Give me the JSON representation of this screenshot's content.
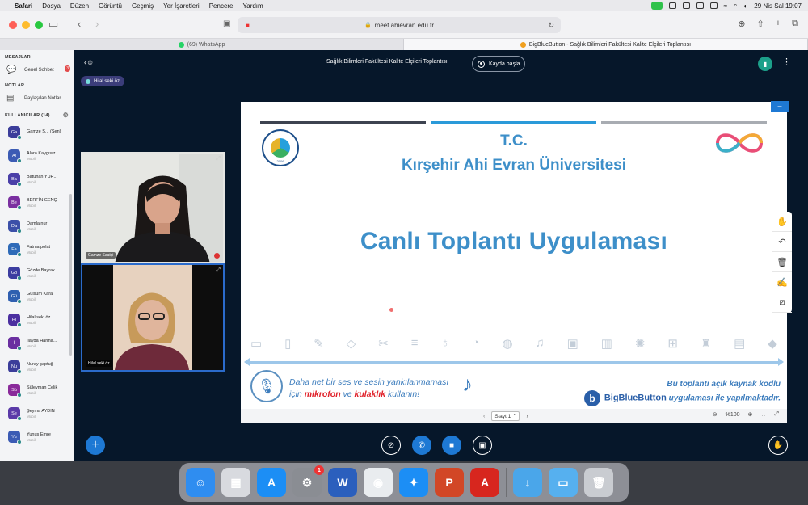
{
  "menubar": {
    "items": [
      "Safari",
      "Dosya",
      "Düzen",
      "Görüntü",
      "Geçmiş",
      "Yer İşaretleri",
      "Pencere",
      "Yardım"
    ],
    "datetime": "29 Nis Sal 19:07"
  },
  "browser": {
    "url": "meet.ahievran.edu.tr",
    "tabs": [
      {
        "label": "(69) WhatsApp"
      },
      {
        "label": "BigBlueButton - Sağlık Bilimleri Fakültesi Kalite Elçileri Toplantısı"
      }
    ]
  },
  "sidebar": {
    "messages_title": "MESAJLAR",
    "public_chat": "Genel Sohbet",
    "public_chat_badge": "3",
    "notes_title": "NOTLAR",
    "shared_notes": "Paylaşılan Notlar",
    "users_title": "KULLANICILAR (14)",
    "users": [
      {
        "initials": "Ga",
        "name": "Gamze S... (Sen)",
        "role": "",
        "color": "#3b3d9a"
      },
      {
        "initials": "Al",
        "name": "Alara Kaygısız",
        "role": "Mobil",
        "color": "#3b5bb4"
      },
      {
        "initials": "Ba",
        "name": "Batuhan YUR...",
        "role": "Mobil",
        "color": "#4a3fa8"
      },
      {
        "initials": "Be",
        "name": "BERFİN GENÇ",
        "role": "Mobil",
        "color": "#7a2fa0"
      },
      {
        "initials": "Da",
        "name": "Damla nur",
        "role": "Mobil",
        "color": "#3b4fa8"
      },
      {
        "initials": "Fa",
        "name": "Fatma polat",
        "role": "Mobil",
        "color": "#2e6ab8"
      },
      {
        "initials": "Gö",
        "name": "Gözde Bayrak",
        "role": "Mobil",
        "color": "#3c3da0"
      },
      {
        "initials": "Gü",
        "name": "Gülsüm Kara",
        "role": "Mobil",
        "color": "#2f5fb0"
      },
      {
        "initials": "Hi",
        "name": "Hilal seki öz",
        "role": "Mobil",
        "color": "#4b2fa0"
      },
      {
        "initials": "İ",
        "name": "İlayda Harma...",
        "role": "Mobil",
        "color": "#6a2fa0"
      },
      {
        "initials": "Nu",
        "name": "Nuray çaptuğ",
        "role": "Mobil",
        "color": "#3b3d9a"
      },
      {
        "initials": "Sü",
        "name": "Süleyman Çelik",
        "role": "Mobil",
        "color": "#8a2a9a"
      },
      {
        "initials": "Şe",
        "name": "Şeyma AYDIN",
        "role": "Mobil",
        "color": "#5a3aa8"
      },
      {
        "initials": "Yu",
        "name": "Yunus Emre",
        "role": "Mobil",
        "color": "#3b5bb4"
      }
    ]
  },
  "meeting": {
    "title": "Sağlık Bilimleri Fakültesi Kalite Elçileri Toplantısı",
    "record_label": "Kayda başla",
    "talker": "Hilal seki öz"
  },
  "webcams": {
    "cam1_label": "Gamze Saatçi",
    "cam2_label": "Hilal seki öz"
  },
  "slide": {
    "tc": "T.C.",
    "university": "Kırşehir Ahi Evran Üniversitesi",
    "seal_year": "2006",
    "main_title": "Canlı Toplantı Uygulaması",
    "notice_line1": "Daha net bir ses ve sesin yankılanmaması",
    "notice_line2_prefix": "için",
    "notice_mic": "mikrofon",
    "notice_and": "ve",
    "notice_headphone": "kulaklık",
    "notice_suffix": "kullanın!",
    "bbb_line1": "Bu toplantı açık kaynak kodlu",
    "bbb_name": "BigBlueButton",
    "bbb_line2_suffix": "uygulaması ile yapılmaktadır.",
    "bar_colors": [
      "#3d4350",
      "#2a9ad9",
      "#a8acb2"
    ]
  },
  "slide_nav": {
    "current": "Slayt 1",
    "zoom": "%100"
  },
  "dock": {
    "items": [
      {
        "name": "finder",
        "glyph": "☺",
        "color": "#2f8df0"
      },
      {
        "name": "launchpad",
        "glyph": "▦",
        "color": "#d8dadf"
      },
      {
        "name": "app-store",
        "glyph": "A",
        "color": "#1c8ef5"
      },
      {
        "name": "system-settings",
        "glyph": "⚙",
        "color": "#8a8d93",
        "badge": "1"
      },
      {
        "name": "word",
        "glyph": "W",
        "color": "#2b5fbd"
      },
      {
        "name": "chrome",
        "glyph": "◉",
        "color": "#e9ecef"
      },
      {
        "name": "safari",
        "glyph": "✦",
        "color": "#1c8ef5"
      },
      {
        "name": "powerpoint",
        "glyph": "P",
        "color": "#d24726"
      },
      {
        "name": "acrobat",
        "glyph": "A",
        "color": "#d7261e"
      },
      {
        "name": "downloads-folder",
        "glyph": "↓",
        "color": "#4aa6ea"
      },
      {
        "name": "folder",
        "glyph": "▭",
        "color": "#56b0ef"
      },
      {
        "name": "trash",
        "glyph": "🗑",
        "color": "#c9ccd1"
      }
    ]
  }
}
